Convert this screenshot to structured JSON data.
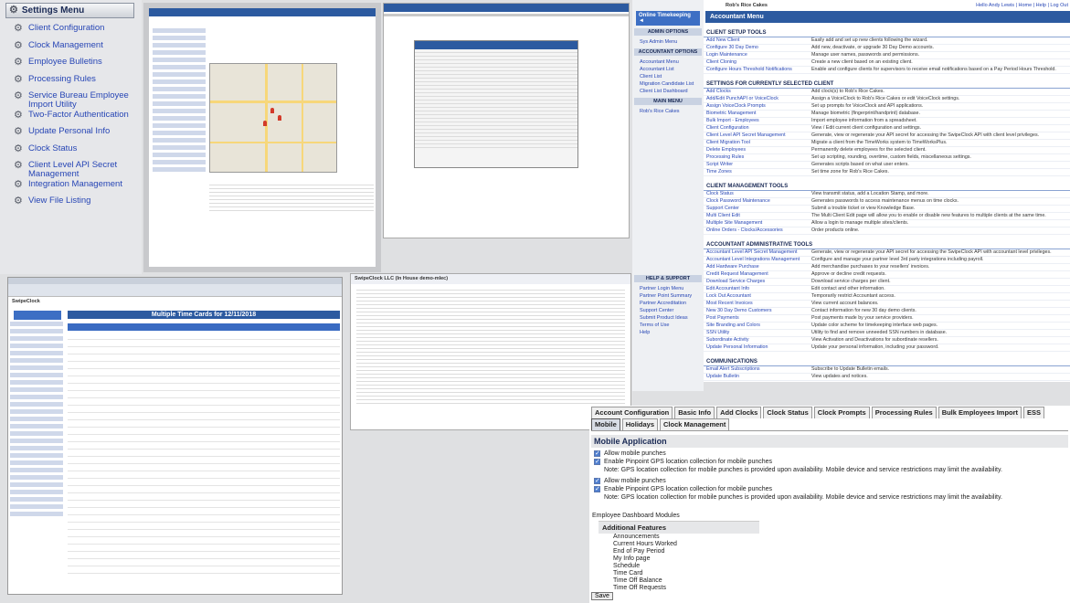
{
  "settings_menu": {
    "title": "Settings Menu",
    "items": [
      {
        "label": "Client Configuration"
      },
      {
        "label": "Clock Management"
      },
      {
        "label": "Employee Bulletins"
      },
      {
        "label": "Processing Rules"
      },
      {
        "label": "Service Bureau Employee Import Utility"
      },
      {
        "label": "Two-Factor Authentication"
      },
      {
        "label": "Update Personal Info"
      },
      {
        "label": "Clock Status"
      },
      {
        "label": "Client Level API Secret Management"
      },
      {
        "label": "Integration Management"
      },
      {
        "label": "View File Listing"
      }
    ]
  },
  "accountant_panel": {
    "online_button": "Online Timekeeping ◄",
    "admin_header": "ADMIN OPTIONS",
    "admin_link": "Sys Admin Menu",
    "accountant_header": "ACCOUNTANT OPTIONS",
    "accountant_links": [
      "Accountant Menu",
      "Accountant List",
      "Client List",
      "Migration Candidate List",
      "Client List Dashboard"
    ],
    "main_header": "MAIN MENU",
    "client": "Rob's Rice Cakes"
  },
  "tools": {
    "header_links": "Hello Andy Lewis | Home | Help | Log Out",
    "client_name": "Rob's Rice Cakes",
    "title": "Accountant Menu",
    "sections": [
      {
        "name": "CLIENT SETUP TOOLS",
        "rows": [
          [
            "Add New Client",
            "Easily add and set up new clients following the wizard."
          ],
          [
            "Configure 30 Day Demo",
            "Add new, deactivate, or upgrade 30 Day Demo accounts."
          ],
          [
            "Login Maintenance",
            "Manage user names, passwords and permissions."
          ],
          [
            "Client Cloning",
            "Create a new client based on an existing client."
          ],
          [
            "Configure Hours Threshold Notifications",
            "Enable and configure clients for supervisors to receive email notifications based on a Pay Period Hours Threshold."
          ]
        ]
      },
      {
        "name": "SETTINGS FOR CURRENTLY SELECTED CLIENT",
        "rows": [
          [
            "Add Clocks",
            "Add clock(s) to Rob's Rice Cakes."
          ],
          [
            "Add/Edit PunchAPI or VoiceClock",
            "Assign a VoiceClock to Rob's Rice Cakes or edit VoiceClock settings."
          ],
          [
            "Assign VoiceClock Prompts",
            "Set up prompts for VoiceClock and API applications."
          ],
          [
            "Biometric Management",
            "Manage biometric (fingerprint/handprint) database."
          ],
          [
            "Bulk Import - Employees",
            "Import employee information from a spreadsheet."
          ],
          [
            "Client Configuration",
            "View / Edit current client configuration and settings."
          ],
          [
            "Client Level API Secret Management",
            "Generate, view or regenerate your API secret for accessing the SwipeClock API with client level privileges."
          ],
          [
            "Client Migration Tool",
            "Migrate a client from the TimeWorks system to TimeWorksPlus."
          ],
          [
            "Delete Employees",
            "Permanently delete employees for the selected client."
          ],
          [
            "Processing Rules",
            "Set up scripting, rounding, overtime, custom fields, miscellaneous settings."
          ],
          [
            "Script Writer",
            "Generates scripts based on what user enters."
          ],
          [
            "Time Zones",
            "Set time zone for Rob's Rice Cakes."
          ]
        ]
      },
      {
        "name": "CLIENT MANAGEMENT TOOLS",
        "rows": [
          [
            "Clock Status",
            "View transmit status, add a Location Stamp, and more."
          ],
          [
            "Clock Password Maintenance",
            "Generates passwords to access maintenance menus on time clocks."
          ],
          [
            "Support Center",
            "Submit a trouble ticket or view Knowledge Base."
          ],
          [
            "Multi Client Edit",
            "The Multi Client Edit page will allow you to enable or disable new features to multiple clients at the same time."
          ],
          [
            "Multiple Site Management",
            "Allow a login to manage multiple sites/clients."
          ],
          [
            "Online Orders - Clocks/Accessories",
            "Order products online."
          ]
        ]
      },
      {
        "name": "ACCOUNTANT ADMINISTRATIVE TOOLS",
        "rows": [
          [
            "Accountant Level API Secret Management",
            "Generate, view or regenerate your API secret for accessing the SwipeClock API with accountant level privileges."
          ],
          [
            "Accountant Level Integrations Management",
            "Configure and manage your partner level 3rd party integrations including payroll."
          ],
          [
            "Add Hardware Purchase",
            "Add merchandise purchases to your resellers' invoices."
          ],
          [
            "Credit Request Management",
            "Approve or decline credit requests."
          ],
          [
            "Download Service Charges",
            "Download service charges per client."
          ],
          [
            "Edit Accountant Info",
            "Edit contact and other information."
          ],
          [
            "Lock Out Accountant",
            "Temporarily restrict Accountant access."
          ],
          [
            "Most Recent Invoices",
            "View current account balances."
          ],
          [
            "New 30 Day Demo Customers",
            "Contact information for new 30 day demo clients."
          ],
          [
            "Post Payments",
            "Post payments made by your service providers."
          ],
          [
            "Site Branding and Colors",
            "Update color scheme for timekeeping interface web pages."
          ],
          [
            "SSN Utility",
            "Utility to find and remove unneeded SSN numbers in database."
          ],
          [
            "Subordinate Activity",
            "View Activation and Deactivations for subordinate resellers."
          ],
          [
            "Update Personal Information",
            "Update your personal information, including your password."
          ]
        ]
      },
      {
        "name": "COMMUNICATIONS",
        "rows": [
          [
            "Email Alert Subscriptions",
            "Subscribe to Update Bulletin emails."
          ],
          [
            "Update Bulletin",
            "View updates and notices."
          ]
        ]
      }
    ]
  },
  "help_support": {
    "header": "HELP & SUPPORT",
    "links": [
      "Partner Login Menu",
      "Partner Point Summary",
      "Partner Accreditation",
      "Support Center",
      "Submit Product Ideas",
      "Terms of Use",
      "Help"
    ]
  },
  "time_cards": {
    "title": "Multiple Time Cards for 12/11/2018",
    "company": "SwipeClock"
  },
  "summary": {
    "title": "SwipeClock LLC (In House demo-mlec)"
  },
  "mobile": {
    "tabs": [
      "Account Configuration",
      "Basic Info",
      "Add Clocks",
      "Clock Status",
      "Clock Prompts",
      "Processing Rules",
      "Bulk Employees Import",
      "ESS",
      "Mobile",
      "Holidays",
      "Clock Management"
    ],
    "active_tab": "Mobile",
    "title": "Mobile Application",
    "group1": {
      "allow": "Allow mobile punches",
      "gps": "Enable Pinpoint GPS location collection for mobile punches",
      "note": "Note: GPS location collection for mobile punches is provided upon availability. Mobile device and service restrictions may limit the availability."
    },
    "group2": {
      "allow": "Allow mobile punches",
      "gps": "Enable Pinpoint GPS location collection for mobile punches",
      "note": "Note: GPS location collection for mobile punches is provided upon availability. Mobile device and service restrictions may limit the availability."
    },
    "dashboard_label": "Employee Dashboard Modules",
    "additional_title": "Additional Features",
    "features": [
      "Announcements",
      "Current Hours Worked",
      "End of Pay Period",
      "My Info page",
      "Schedule",
      "Time Card",
      "Time Off Balance",
      "Time Off Requests"
    ],
    "save_label": "Save"
  }
}
